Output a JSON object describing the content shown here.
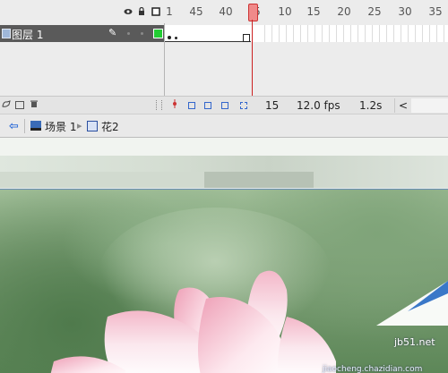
{
  "timeline": {
    "frame_numbers": [
      "1",
      "5",
      "10",
      "15",
      "20",
      "25",
      "30",
      "35",
      "40",
      "45"
    ],
    "layer": {
      "name": "图层 1",
      "color": "#22cc33"
    },
    "current_frame": "15",
    "fps": "12.0 fps",
    "elapsed": "1.2s",
    "scroll_left": "<",
    "icons": {
      "eye": "eye-icon",
      "lock": "lock-icon",
      "outline": "outline-icon",
      "pencil": "pencil-icon",
      "new_layer": "new-layer-icon",
      "folder": "folder-icon",
      "trash": "trash-icon"
    },
    "playhead_color": "#f08a8a"
  },
  "edit_bar": {
    "scene_label": "场景 1",
    "symbol_label": "花2",
    "back_icon": "back-arrow-icon"
  },
  "watermark": {
    "site": "jb51.net",
    "domain": "jiaocheng.chazidian.com"
  }
}
